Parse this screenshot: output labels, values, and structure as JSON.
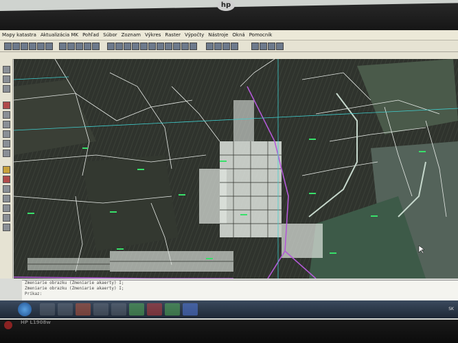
{
  "monitor": {
    "brand": "hp",
    "model": "HP L1908w"
  },
  "menu": {
    "items": [
      "Mapy katastra",
      "Aktualizácia MK",
      "Pohľad",
      "Súbor",
      "Zoznam",
      "Výkres",
      "Raster",
      "Výpočty",
      "Nástroje",
      "Okná",
      "Pomocník"
    ]
  },
  "command_window": {
    "lines": [
      "Zmeniarie obrazku (Zmeniarie akaerty) I;",
      "Zmeniarie obrazku (Zmeniarie akaerty) I;",
      "Príkaz:"
    ]
  },
  "taskbar": {
    "tray_text": "SK",
    "apps": [
      "explorer-icon",
      "media-player-icon",
      "chrome-icon",
      "folder-icon",
      "gis-app-icon",
      "pdf-icon",
      "map-app-icon",
      "save-icon"
    ]
  },
  "map": {
    "background": "#2b2e29",
    "parcel_color": "#e8ece8",
    "road_color": "#b45ad8",
    "gridline_color": "#3fd0d0",
    "label_color": "#38e06a"
  }
}
